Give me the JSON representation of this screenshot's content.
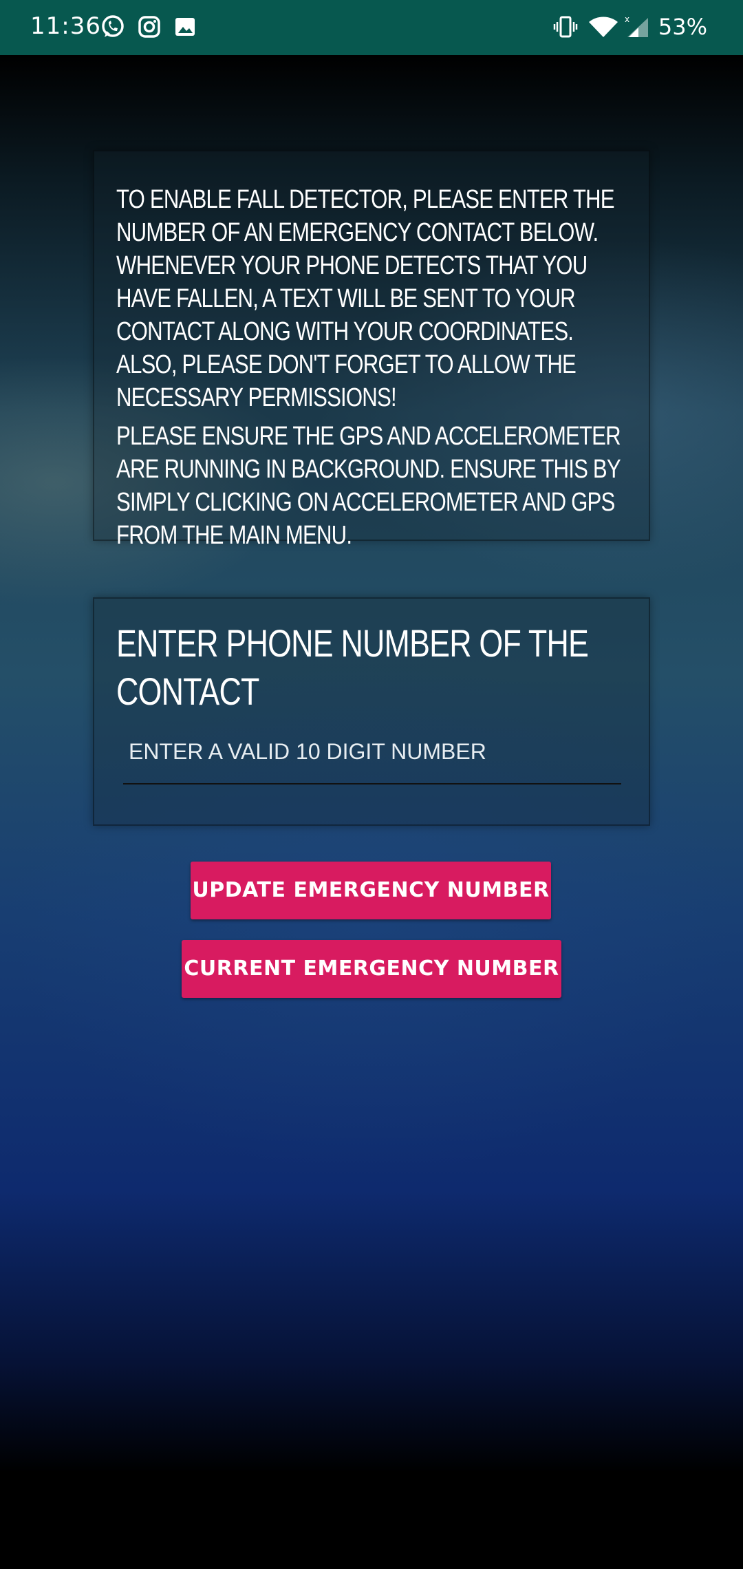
{
  "status_bar": {
    "time": "11:36",
    "notification_icons": [
      "whatsapp-icon",
      "instagram-icon",
      "gallery-icon"
    ],
    "system_icons": [
      "vibrate-icon",
      "wifi-icon",
      "cellular-signal-icon"
    ],
    "battery": "53%",
    "color": "#07584f"
  },
  "info_card": {
    "paragraph_1": "To enable fall detector, please enter the number of an emergency contact below. Whenever your phone detects that you have fallen, a text will be sent to your contact along with your coordinates. Also, please don't forget to allow the necessary permissions!",
    "paragraph_2": "Please ensure the GPS and Accelerometer are running in background. Ensure this by simply clicking on accelerometer and GPS from the main menu."
  },
  "contact_card": {
    "heading": "Enter phone number of the contact",
    "input_value": "",
    "input_placeholder": "Enter a valid 10 digit number"
  },
  "buttons": {
    "update_label": "UPDATE EMERGENCY NUMBER",
    "current_label": "CURRENT EMERGENCY NUMBER",
    "color": "#d81b60"
  }
}
